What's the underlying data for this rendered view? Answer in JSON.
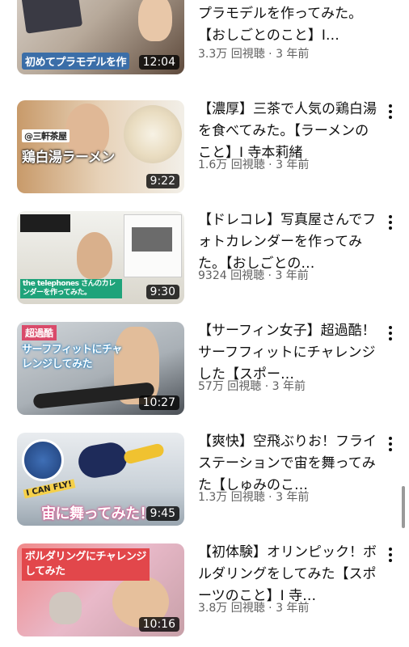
{
  "videos": [
    {
      "title": "【ガールガンレディ】初めてプラモデルを作ってみた。【おしごとのこと】I…",
      "views": "3.3万 回視聴",
      "age": "3 年前",
      "duration": "12:04",
      "thumb_text": "初めてプラモデルを作"
    },
    {
      "title": "【濃厚】三茶で人気の鶏白湯を食べてみた。【ラーメンのこと】I 寺本莉緒",
      "views": "1.6万 回視聴",
      "age": "3 年前",
      "duration": "9:22",
      "thumb_text": "鶏白湯ラーメン"
    },
    {
      "title": "【ドレコレ】写真屋さんでフォトカレンダーを作ってみた。【おしごとの…",
      "views": "9324 回視聴",
      "age": "3 年前",
      "duration": "9:30",
      "thumb_text": "the telephones さんのカレンダーを作ってみた。"
    },
    {
      "title": "【サーフィン女子】超過酷！サーフフィットにチャレンジした【スポー…",
      "views": "57万 回視聴",
      "age": "3 年前",
      "duration": "10:27",
      "thumb_text": "サーフフィットにチャレンジしてみた"
    },
    {
      "title": "【爽快】空飛ぶりお！フライステーションで宙を舞ってみた【しゅみのこ…",
      "views": "1.3万 回視聴",
      "age": "3 年前",
      "duration": "9:45",
      "thumb_text": "宙に舞ってみた！"
    },
    {
      "title": "【初体験】オリンピック！ボルダリングをしてみた【スポーツのこと】I 寺…",
      "views": "3.8万 回視聴",
      "age": "3 年前",
      "duration": "10:16",
      "thumb_text": "ボルダリングにチャレンジしてみた"
    }
  ],
  "separator": "·",
  "colors": {
    "text": "#0f0f0f",
    "meta": "#606060",
    "duration_bg": "#000000"
  },
  "icons": [
    "more-vert-icon"
  ]
}
